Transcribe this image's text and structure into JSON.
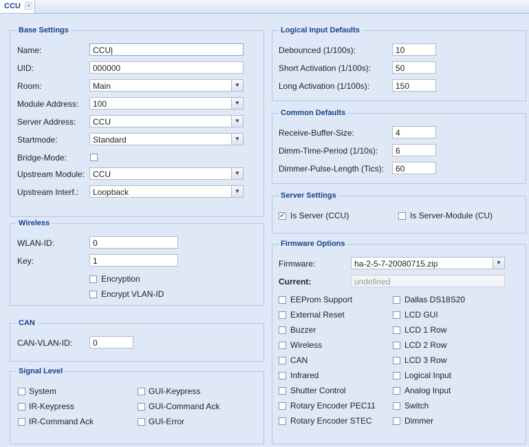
{
  "tab": {
    "title": "CCU",
    "close": "×"
  },
  "base": {
    "legend": "Base Settings",
    "name_label": "Name:",
    "name_value": "CCU",
    "uid_label": "UID:",
    "uid_value": "000000",
    "room_label": "Room:",
    "room_value": "Main",
    "module_label": "Module Address:",
    "module_value": "100",
    "server_label": "Server Address:",
    "server_value": "CCU",
    "startmode_label": "Startmode:",
    "startmode_value": "Standard",
    "bridge_label": "Bridge-Mode:",
    "upmod_label": "Upstream Module:",
    "upmod_value": "CCU",
    "upint_label": "Upstream Interf.:",
    "upint_value": "Loopback"
  },
  "wireless": {
    "legend": "Wireless",
    "wlan_label": "WLAN-ID:",
    "wlan_value": "0",
    "key_label": "Key:",
    "key_value": "1",
    "encryption_label": "Encryption",
    "encrypt_vlan_label": "Encrypt VLAN-ID"
  },
  "can": {
    "legend": "CAN",
    "vlan_label": "CAN-VLAN-ID:",
    "vlan_value": "0"
  },
  "signal": {
    "legend": "Signal Level",
    "items": [
      "System",
      "GUI-Keypress",
      "IR-Keypress",
      "GUI-Command Ack",
      "IR-Command Ack",
      "GUI-Error"
    ]
  },
  "logical": {
    "legend": "Logical Input Defaults",
    "debounced_label": "Debounced (1/100s):",
    "debounced_value": "10",
    "short_label": "Short Activation (1/100s):",
    "short_value": "50",
    "long_label": "Long Activation (1/100s):",
    "long_value": "150"
  },
  "common": {
    "legend": "Common Defaults",
    "rx_label": "Receive-Buffer-Size:",
    "rx_value": "4",
    "dimm_label": "Dimm-Time-Period (1/10s):",
    "dimm_value": "6",
    "pulse_label": "Dimmer-Pulse-Length (Tics):",
    "pulse_value": "60"
  },
  "server": {
    "legend": "Server Settings",
    "is_server_label": "Is Server (CCU)",
    "is_server_checked": "✓",
    "is_module_label": "Is Server-Module (CU)"
  },
  "firmware": {
    "legend": "Firmware Options",
    "fw_label": "Firmware:",
    "fw_value": "ha-2-5-7-20080715.zip",
    "current_label": "Current:",
    "current_placeholder": "undefined",
    "left": [
      "EEProm Support",
      "External Reset",
      "Buzzer",
      "Wireless",
      "CAN",
      "Infrared",
      "Shutter Control",
      "Rotary Encoder PEC11",
      "Rotary Encoder STEC"
    ],
    "right": [
      "Dallas DS18S20",
      "LCD GUI",
      "LCD 1 Row",
      "LCD 2 Row",
      "LCD 3 Row",
      "Logical Input",
      "Analog Input",
      "Switch",
      "Dimmer"
    ]
  }
}
